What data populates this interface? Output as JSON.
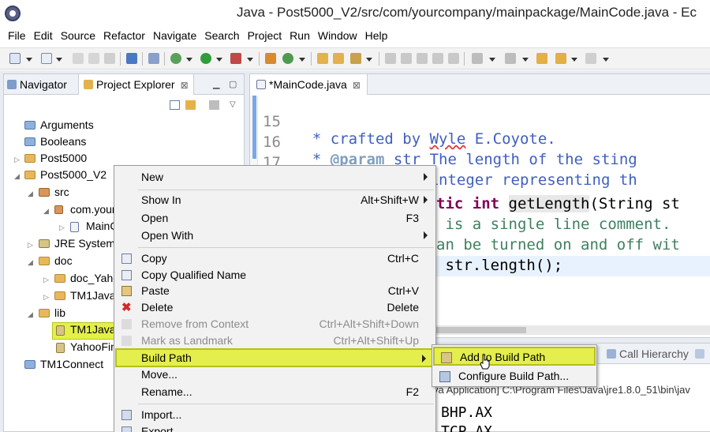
{
  "window": {
    "title": "Java - Post5000_V2/src/com/yourcompany/mainpackage/MainCode.java - Ec"
  },
  "menubar": [
    "File",
    "Edit",
    "Source",
    "Refactor",
    "Navigate",
    "Search",
    "Project",
    "Run",
    "Window",
    "Help"
  ],
  "left_view": {
    "tabs": [
      {
        "label": "Navigator",
        "icon": "navigator-icon"
      },
      {
        "label": "Project Explorer",
        "icon": "project-explorer-icon",
        "close": "⊠"
      }
    ],
    "tree": [
      {
        "label": "Arguments",
        "icon": "folder-icon"
      },
      {
        "label": "Booleans",
        "icon": "folder-icon"
      },
      {
        "label": "Post5000",
        "icon": "project-icon"
      },
      {
        "label": "Post5000_V2",
        "icon": "project-icon"
      },
      {
        "label": "src",
        "icon": "source-folder-icon"
      },
      {
        "label": "com.your",
        "icon": "package-icon"
      },
      {
        "label": "MainC",
        "icon": "java-file-icon"
      },
      {
        "label": "JRE System L",
        "icon": "library-icon"
      },
      {
        "label": "doc",
        "icon": "folder-icon"
      },
      {
        "label": "doc_Yaho",
        "icon": "folder-icon"
      },
      {
        "label": "TM1JavaA",
        "icon": "folder-icon"
      },
      {
        "label": "lib",
        "icon": "folder-icon"
      },
      {
        "label": "TM1JavaA",
        "icon": "jar-icon"
      },
      {
        "label": "YahooFin",
        "icon": "jar-icon"
      },
      {
        "label": "TM1Connect",
        "icon": "folder-icon"
      }
    ]
  },
  "editor": {
    "tab_label": "*MainCode.java",
    "tab_close": "⊠",
    "lines": [
      {
        "num": "15",
        "text": "  * crafted by Wyle E.Coyote."
      },
      {
        "num": "16",
        "text": "  * @param str The length of the sting"
      },
      {
        "num": "17",
        "text": "  * @return An integer representing th"
      },
      {
        "num": "18",
        "text": "  */"
      },
      {
        "num": "",
        "text": "tic int getLength(String st"
      },
      {
        "num": "",
        "text": " is a single line comment."
      },
      {
        "num": "",
        "text": "an be turned on and off wit"
      },
      {
        "num": "",
        "text": " str.length();"
      }
    ]
  },
  "bottom_view": {
    "tab_call_hierarchy": "Call Hierarchy",
    "console_header": "va Application] C:\\Program Files\\Java\\jre1.8.0_51\\bin\\jav",
    "console_lines": [
      "BHP.AX",
      "TCP.AX"
    ]
  },
  "context_menu": {
    "items": [
      {
        "label": "New",
        "shortcut": "",
        "submenu": true
      },
      {
        "label": "Show In",
        "shortcut": "Alt+Shift+W",
        "submenu": true
      },
      {
        "label": "Open",
        "shortcut": "F3"
      },
      {
        "label": "Open With",
        "shortcut": "",
        "submenu": true
      },
      {
        "label": "Copy",
        "shortcut": "Ctrl+C",
        "icon": "copy-icon"
      },
      {
        "label": "Copy Qualified Name",
        "shortcut": "",
        "icon": "copy-qualified-icon"
      },
      {
        "label": "Paste",
        "shortcut": "Ctrl+V",
        "icon": "paste-icon"
      },
      {
        "label": "Delete",
        "shortcut": "Delete",
        "icon": "delete-icon"
      },
      {
        "label": "Remove from Context",
        "shortcut": "Ctrl+Alt+Shift+Down",
        "disabled": true
      },
      {
        "label": "Mark as Landmark",
        "shortcut": "Ctrl+Alt+Shift+Up",
        "disabled": true
      },
      {
        "label": "Build Path",
        "shortcut": "",
        "submenu": true,
        "selected": true
      },
      {
        "label": "Move...",
        "shortcut": ""
      },
      {
        "label": "Rename...",
        "shortcut": "F2"
      },
      {
        "label": "Import...",
        "shortcut": "",
        "icon": "import-icon"
      },
      {
        "label": "Export...",
        "shortcut": "",
        "icon": "export-icon"
      }
    ]
  },
  "submenu": {
    "items": [
      {
        "label": "Add to Build Path",
        "icon": "jar-add-icon",
        "selected": true
      },
      {
        "label": "Configure Build Path...",
        "icon": "configure-icon"
      }
    ]
  },
  "colors": {
    "highlight": "#e4ee4c",
    "javadoc": "#3f5fbf",
    "keyword": "#7f0055",
    "comment": "#3f7f5f"
  }
}
